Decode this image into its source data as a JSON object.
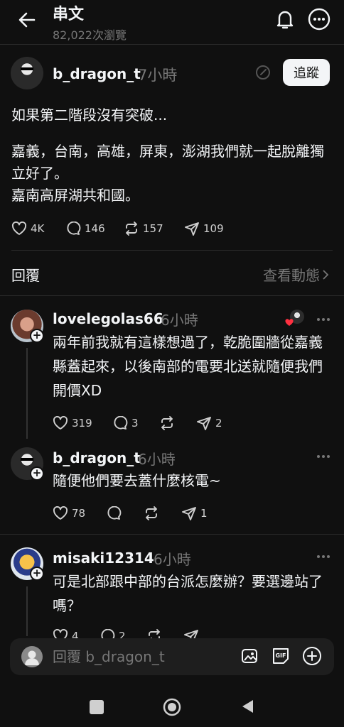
{
  "header": {
    "title": "串文",
    "views": "82,022次瀏覽"
  },
  "post": {
    "username": "b_dragon_t",
    "time": "7小時",
    "follow_label": "追蹤",
    "paragraph1": "如果第二階段沒有突破...",
    "paragraph2_line1": "嘉義，台南，高雄，屏東，澎湖我們就一起脫離獨立好了。",
    "paragraph2_line2": "嘉南高屏湖共和國。",
    "likes": "4K",
    "comments": "146",
    "reposts": "157",
    "shares": "109"
  },
  "replies_section": {
    "label": "回覆",
    "view_activity": "查看動態"
  },
  "comments": [
    {
      "username": "lovelegolas66",
      "time": "6小時",
      "text": "兩年前我就有這樣想過了，乾脆圍牆從嘉義縣蓋起來，以後南部的電要北送就隨便我們開價XD",
      "likes": "319",
      "comments": "3",
      "shares": "2"
    },
    {
      "username": "b_dragon_t",
      "time": "6小時",
      "text": "隨便他們要去蓋什麼核電~",
      "likes": "78",
      "shares": "1"
    },
    {
      "username": "misaki12314",
      "time": "6小時",
      "text": "可是北部跟中部的台派怎麼辦？要選邊站了嗎？",
      "likes": "4",
      "comments": "2"
    }
  ],
  "reply_bar": {
    "placeholder": "回覆 b_dragon_t"
  },
  "colors": {
    "background": "#101010",
    "text": "#f3f5f7",
    "muted": "#777777",
    "heart": "#ff3040"
  }
}
